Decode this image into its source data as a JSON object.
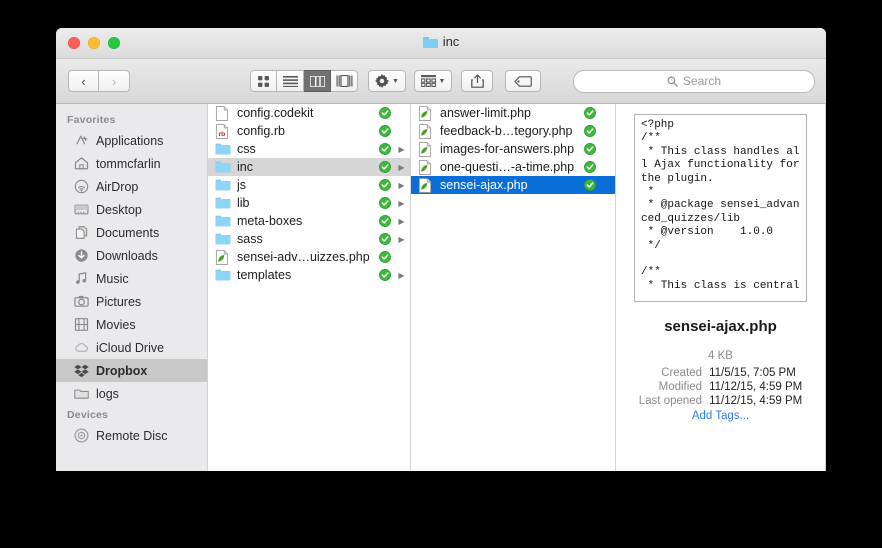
{
  "window": {
    "title": "inc",
    "traffic_lights": [
      "close-red",
      "minimize-yellow",
      "zoom-green"
    ]
  },
  "toolbar": {
    "back_label": "‹",
    "forward_label": "›",
    "view_icon": "icon-view",
    "view_list": "list-view",
    "view_column": "column-view",
    "view_gallery": "gallery-view",
    "action_label": "gear-icon",
    "arrange_label": "arrange-icon",
    "share_label": "share-icon",
    "tags_label": "tag-icon",
    "search_placeholder": "Search"
  },
  "sidebar": {
    "sections": [
      {
        "header": "Favorites",
        "items": [
          {
            "label": "Applications",
            "icon": "applications-icon",
            "selected": false
          },
          {
            "label": "tommcfarlin",
            "icon": "home-icon",
            "selected": false
          },
          {
            "label": "AirDrop",
            "icon": "airdrop-icon",
            "selected": false
          },
          {
            "label": "Desktop",
            "icon": "desktop-icon",
            "selected": false
          },
          {
            "label": "Documents",
            "icon": "documents-icon",
            "selected": false
          },
          {
            "label": "Downloads",
            "icon": "downloads-icon",
            "selected": false
          },
          {
            "label": "Music",
            "icon": "music-icon",
            "selected": false
          },
          {
            "label": "Pictures",
            "icon": "pictures-icon",
            "selected": false
          },
          {
            "label": "Movies",
            "icon": "movies-icon",
            "selected": false
          },
          {
            "label": "iCloud Drive",
            "icon": "icloud-icon",
            "selected": false
          },
          {
            "label": "Dropbox",
            "icon": "dropbox-icon",
            "selected": true
          },
          {
            "label": "logs",
            "icon": "folder-icon",
            "selected": false
          }
        ]
      },
      {
        "header": "Devices",
        "items": [
          {
            "label": "Remote Disc",
            "icon": "disc-icon",
            "selected": false
          }
        ]
      }
    ]
  },
  "columns": [
    {
      "name": "column-one",
      "rows": [
        {
          "label": "config.codekit",
          "icon": "blank-document-icon",
          "badge": "synced-check",
          "disclosure": false,
          "state": "none"
        },
        {
          "label": "config.rb",
          "icon": "ruby-document-icon",
          "badge": "synced-check",
          "disclosure": false,
          "state": "none"
        },
        {
          "label": "css",
          "icon": "folder-icon",
          "badge": "synced-check",
          "disclosure": true,
          "state": "none"
        },
        {
          "label": "inc",
          "icon": "folder-icon",
          "badge": "synced-check",
          "disclosure": true,
          "state": "gray"
        },
        {
          "label": "js",
          "icon": "folder-icon",
          "badge": "synced-check",
          "disclosure": true,
          "state": "none"
        },
        {
          "label": "lib",
          "icon": "folder-icon",
          "badge": "synced-check",
          "disclosure": true,
          "state": "none"
        },
        {
          "label": "meta-boxes",
          "icon": "folder-icon",
          "badge": "synced-check",
          "disclosure": true,
          "state": "none"
        },
        {
          "label": "sass",
          "icon": "folder-icon",
          "badge": "synced-check",
          "disclosure": true,
          "state": "none"
        },
        {
          "label": "sensei-adv…uizzes.php",
          "icon": "php-document-icon",
          "badge": "synced-check",
          "disclosure": false,
          "state": "none"
        },
        {
          "label": "templates",
          "icon": "folder-icon",
          "badge": "synced-check",
          "disclosure": true,
          "state": "none"
        }
      ]
    },
    {
      "name": "column-two",
      "rows": [
        {
          "label": "answer-limit.php",
          "icon": "php-document-icon",
          "badge": "synced-check",
          "disclosure": false,
          "state": "none"
        },
        {
          "label": "feedback-b…tegory.php",
          "icon": "php-document-icon",
          "badge": "synced-check",
          "disclosure": false,
          "state": "none"
        },
        {
          "label": "images-for-answers.php",
          "icon": "php-document-icon",
          "badge": "synced-check",
          "disclosure": false,
          "state": "none"
        },
        {
          "label": "one-questi…-a-time.php",
          "icon": "php-document-icon",
          "badge": "synced-check",
          "disclosure": false,
          "state": "none"
        },
        {
          "label": "sensei-ajax.php",
          "icon": "php-document-icon",
          "badge": "synced-check",
          "disclosure": false,
          "state": "blue"
        }
      ]
    }
  ],
  "preview": {
    "code": "<?php\n/**\n * This class handles all Ajax functionality for the plugin.\n *\n * @package sensei_advanced_quizzes/lib\n * @version    1.0.0\n */\n\n/**\n * This class is central",
    "filename": "sensei-ajax.php",
    "size": "4 KB",
    "meta": [
      {
        "key": "Created",
        "value": "11/5/15, 7:05 PM"
      },
      {
        "key": "Modified",
        "value": "11/12/15, 4:59 PM"
      },
      {
        "key": "Last opened",
        "value": "11/12/15, 4:59 PM"
      }
    ],
    "add_tags_label": "Add Tags..."
  },
  "colors": {
    "selection_blue": "#0a6ed8",
    "sidebar_selection_gray": "#c8c8c8",
    "row_selection_gray": "#d6d6d6",
    "sync_badge_green": "#3db83d",
    "folder_blue": "#7ecef3",
    "link_blue": "#2a7de1"
  }
}
